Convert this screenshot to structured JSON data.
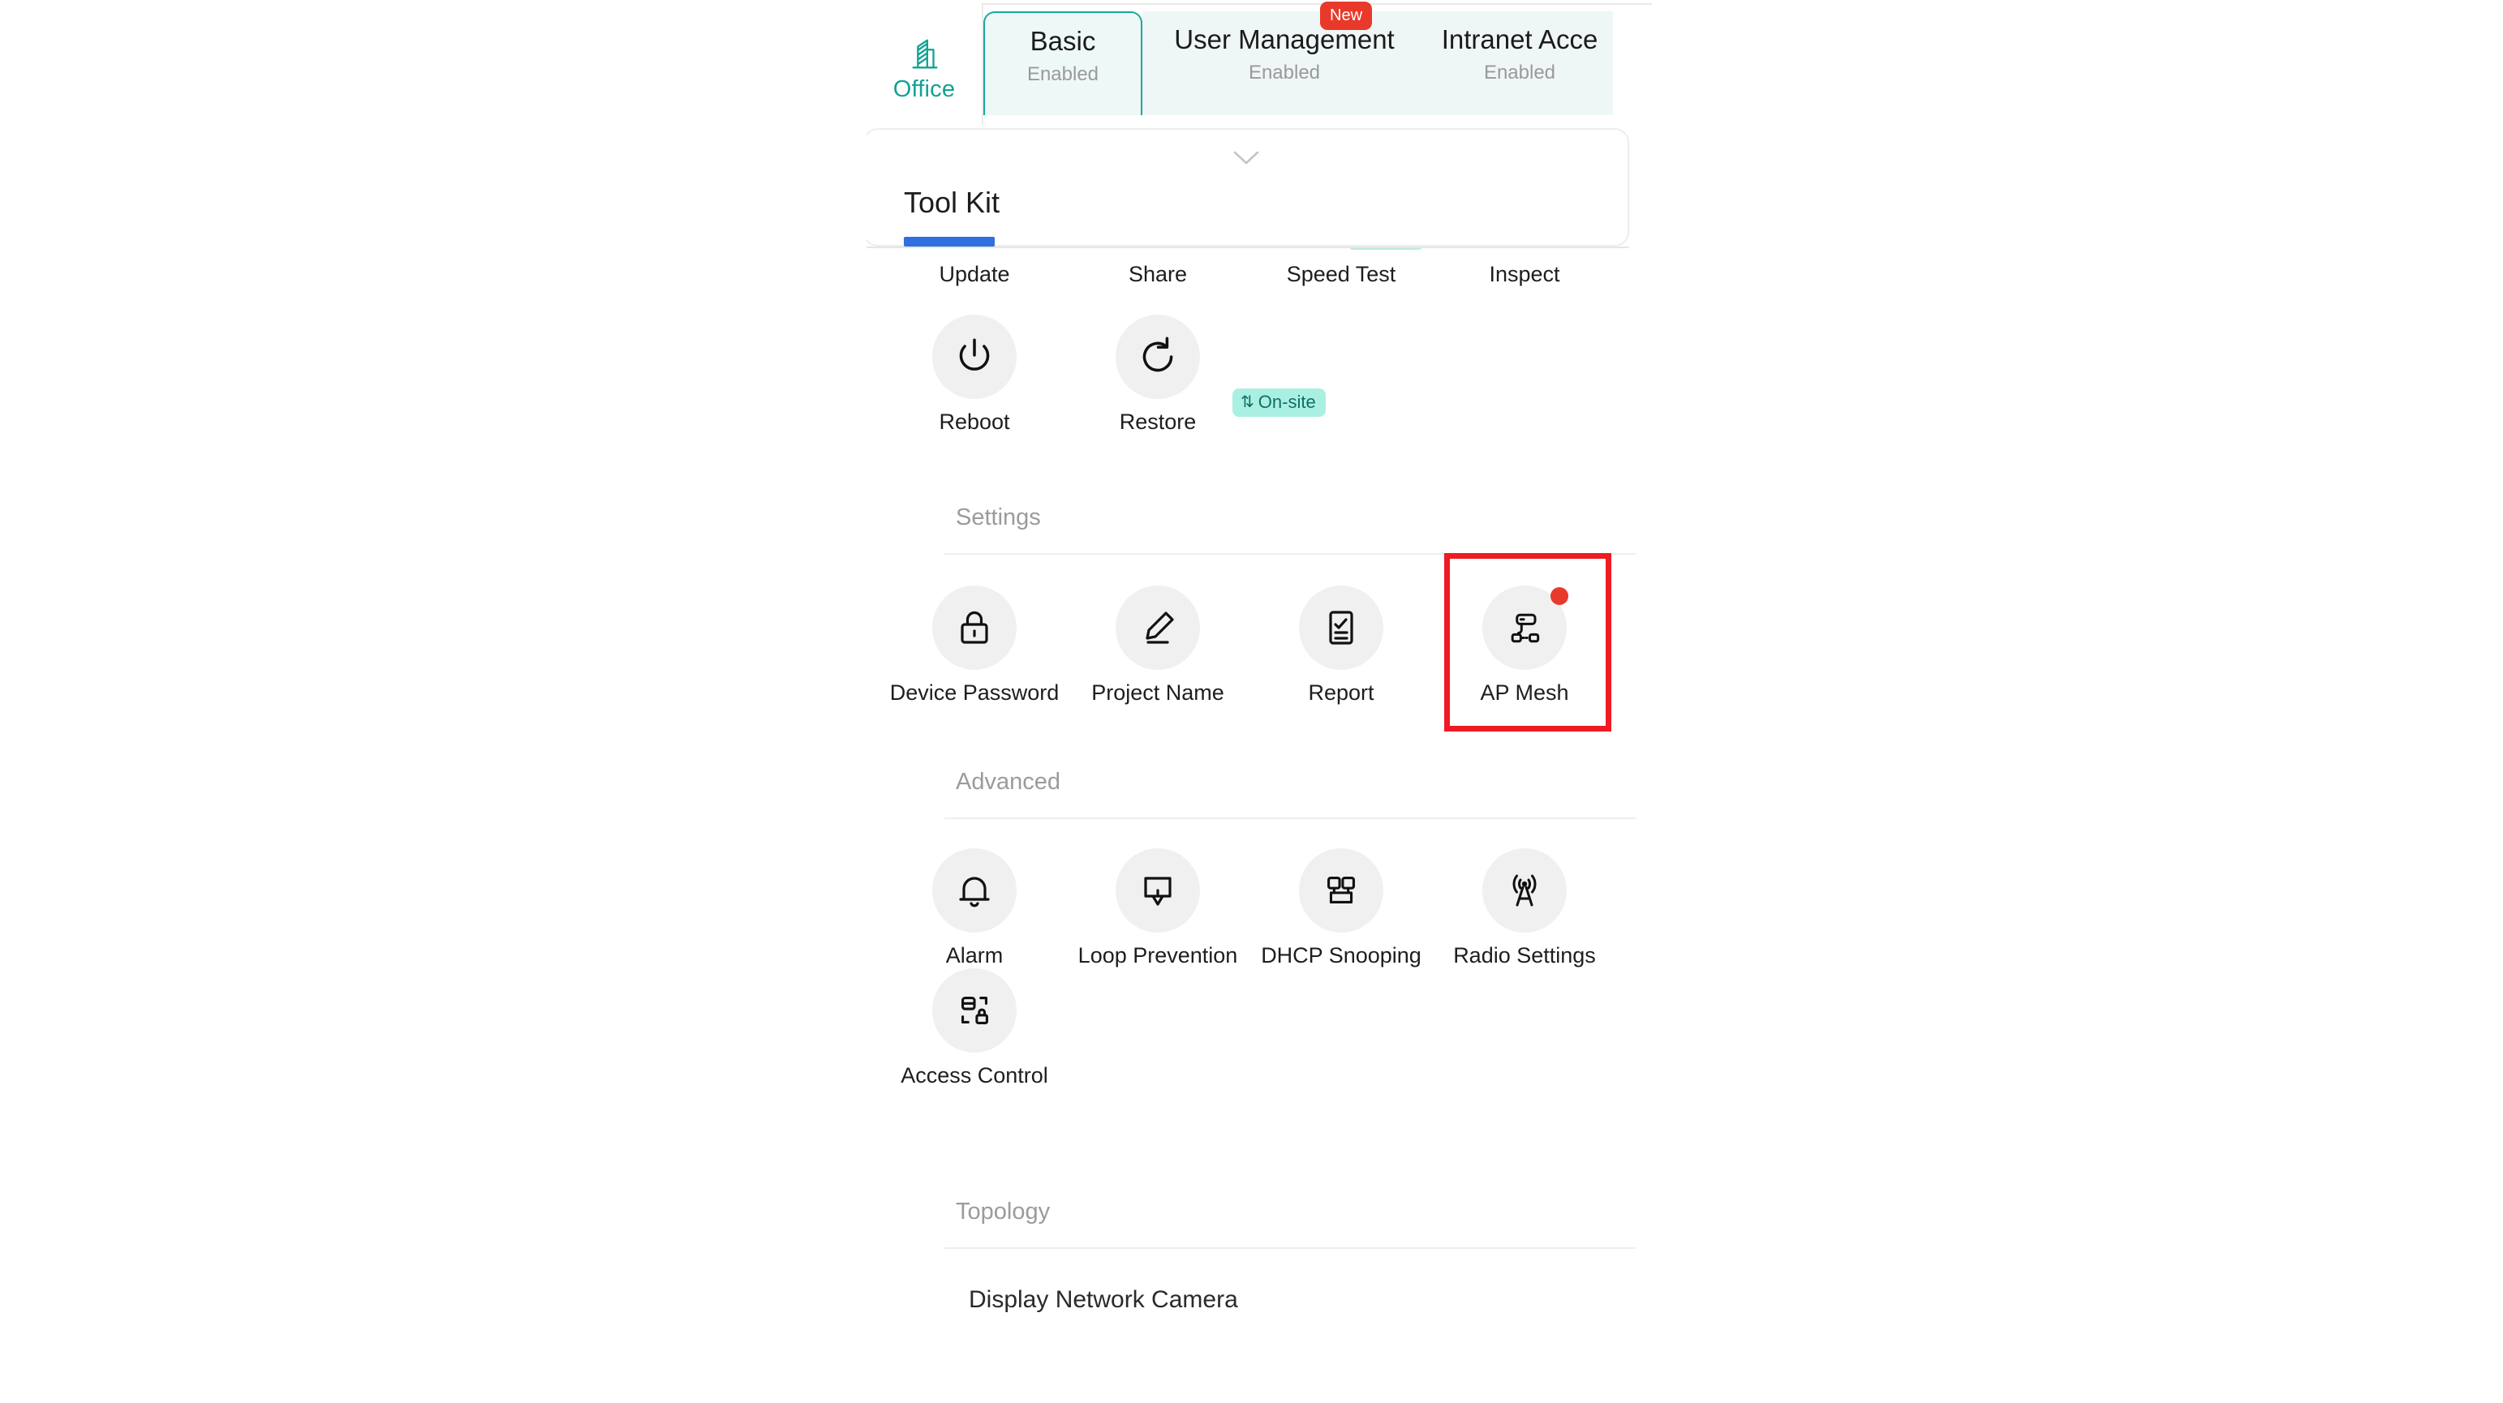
{
  "site": {
    "name": "Office",
    "icon": "building-icon"
  },
  "tabs": [
    {
      "label": "Basic",
      "status": "Enabled",
      "active": true,
      "badge": ""
    },
    {
      "label": "User Management",
      "status": "Enabled",
      "active": false,
      "badge": "New"
    },
    {
      "label": "Intranet Acce",
      "status": "Enabled",
      "active": false,
      "badge": ""
    }
  ],
  "toolkit_panel": {
    "title": "Tool Kit",
    "chevron_icon": "chevron-down-icon",
    "accent_color": "#2f6fe0"
  },
  "tools_row": {
    "labels": [
      "Update",
      "Share",
      "Speed Test",
      "Inspect"
    ]
  },
  "actions_row": [
    {
      "label": "Reboot",
      "icon": "power-icon",
      "badge": ""
    },
    {
      "label": "Restore",
      "icon": "refresh-icon",
      "badge": "On-site"
    }
  ],
  "sections": [
    {
      "title": "Settings",
      "items": [
        {
          "label": "Device Password",
          "icon": "lock-icon",
          "dot": false
        },
        {
          "label": "Project Name",
          "icon": "pencil-icon",
          "dot": false
        },
        {
          "label": "Report",
          "icon": "report-checklist-icon",
          "dot": false
        },
        {
          "label": "AP Mesh",
          "icon": "mesh-network-icon",
          "dot": true
        }
      ]
    },
    {
      "title": "Advanced",
      "items": [
        {
          "label": "Alarm",
          "icon": "bell-icon",
          "dot": false
        },
        {
          "label": "Loop Prevention",
          "icon": "loop-alert-icon",
          "dot": false
        },
        {
          "label": "DHCP Snooping",
          "icon": "dhcp-nodes-icon",
          "dot": false
        },
        {
          "label": "Radio Settings",
          "icon": "radio-tower-icon",
          "dot": false
        },
        {
          "label": "Access Control",
          "icon": "server-lock-icon",
          "dot": false
        }
      ]
    },
    {
      "title": "Topology",
      "items": []
    }
  ],
  "topology": {
    "toggle_label": "Display Network Camera",
    "toggle_on": true,
    "toggle_color": "#2f6fe0"
  },
  "annotation": {
    "highlight_target": "AP Mesh",
    "highlight_color": "#ee1b24"
  },
  "colors": {
    "site_teal": "#12a294",
    "tab_active_border": "#19a99a",
    "badge_new": "#e8392a",
    "onsite_bg": "#aaf0e2",
    "onsite_text": "#0f6f62",
    "icon_circle_bg": "#f0f0f1"
  }
}
